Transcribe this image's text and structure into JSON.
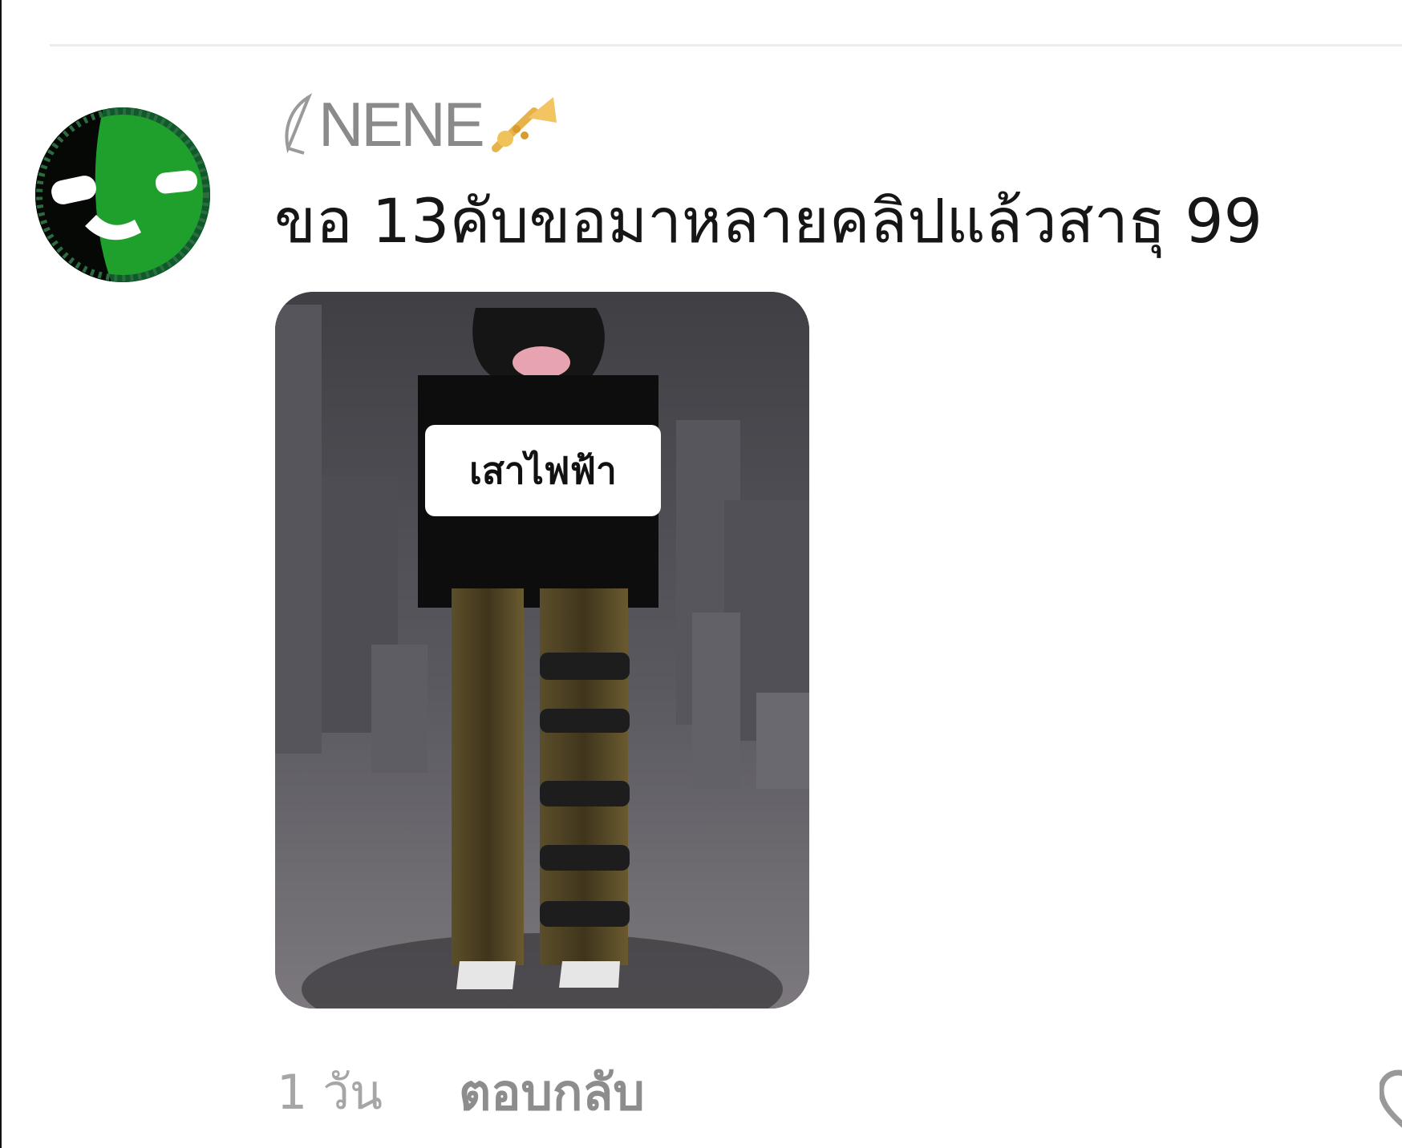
{
  "comment": {
    "username": "NENE",
    "text": "ขอ 13คับขอมาหลายคลิปแล้วสาธุ 99",
    "time": "1 วัน",
    "reply_label": "ตอบกลับ",
    "image_sticker_text": "เสาไฟฟ้า",
    "icons": {
      "username_prefix": "leaf-icon",
      "username_suffix": "trumpet-icon",
      "action": "like-icon"
    }
  },
  "colors": {
    "username": "#8a8a8a",
    "comment_text": "#161616",
    "meta": "#a6a6a6",
    "reply": "#8d8d8d",
    "avatar_green": "#1f9a2a"
  }
}
